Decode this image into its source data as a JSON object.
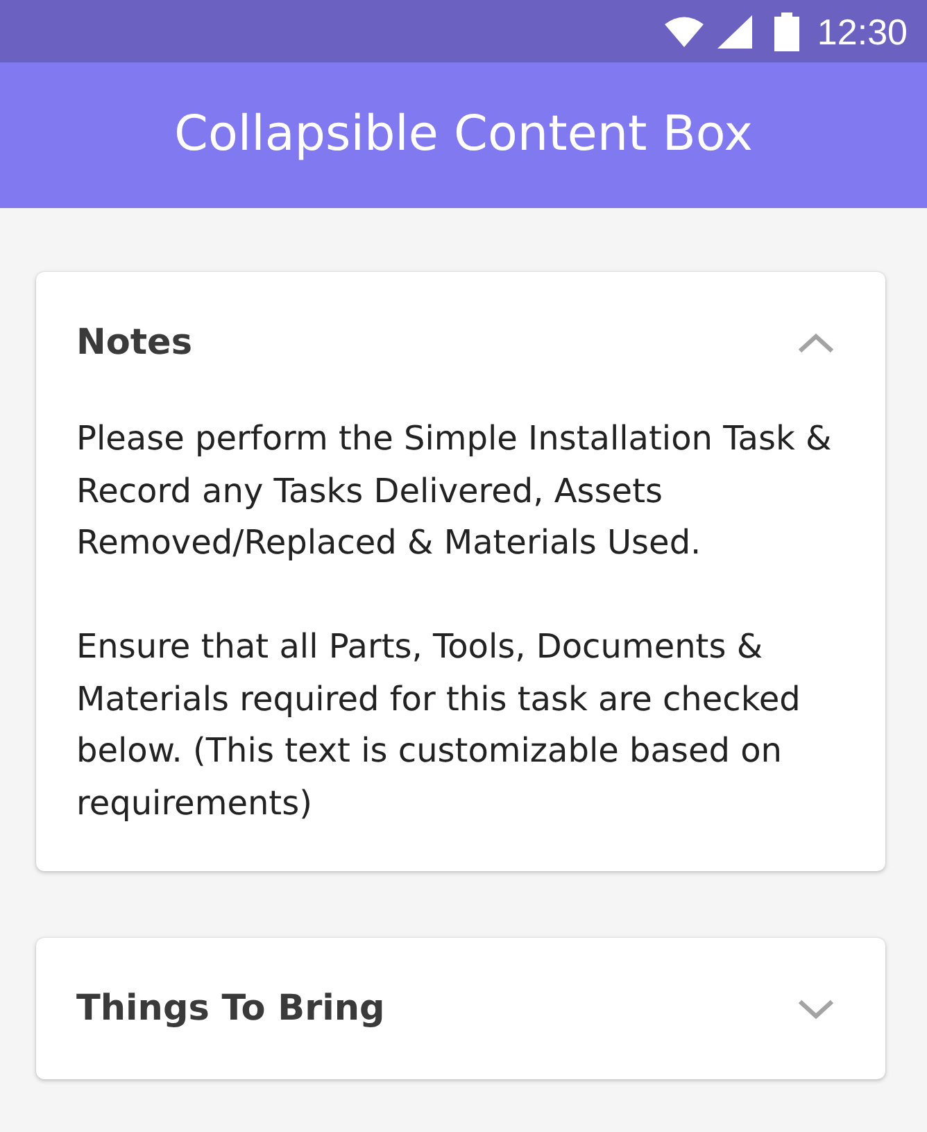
{
  "status_bar": {
    "time": "12:30"
  },
  "app_bar": {
    "title": "Collapsible Content Box"
  },
  "sections": [
    {
      "title": "Notes",
      "expanded": true,
      "paragraphs": [
        "Please perform the Simple Installation Task & Record any Tasks Delivered, Assets Removed/Replaced & Materials Used.",
        "Ensure that all Parts, Tools, Documents & Materials required for this task are checked below. (This text is customizable based on requirements)"
      ]
    },
    {
      "title": "Things To Bring",
      "expanded": false
    }
  ]
}
